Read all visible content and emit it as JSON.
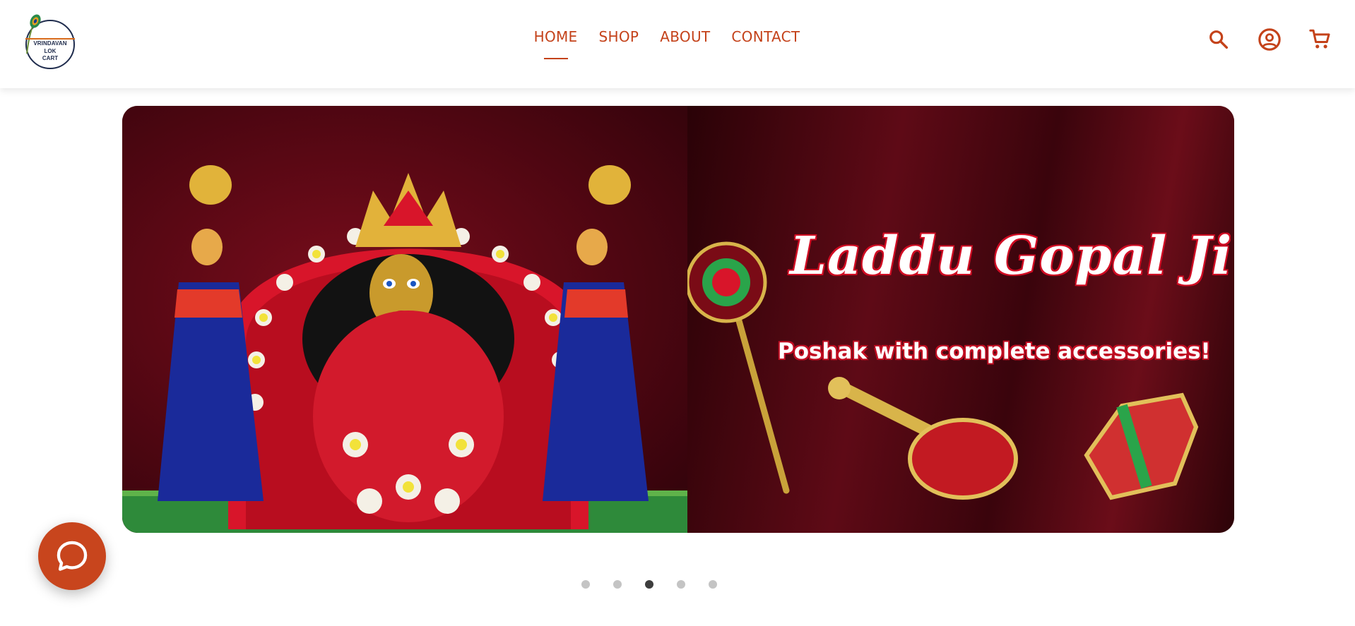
{
  "brand": {
    "logo_line1": "VRINDAVAN",
    "logo_line2": "LOK",
    "logo_line3": "CART"
  },
  "nav": {
    "items": [
      {
        "label": "HOME",
        "active": true
      },
      {
        "label": "SHOP",
        "active": false
      },
      {
        "label": "ABOUT",
        "active": false
      },
      {
        "label": "CONTACT",
        "active": false
      }
    ]
  },
  "header_icons": [
    "search-icon",
    "account-icon",
    "cart-icon"
  ],
  "banner": {
    "title": "Laddu Gopal Ji",
    "subtitle": "Poshak with complete accessories!"
  },
  "carousel": {
    "total_slides": 5,
    "active_index": 2
  },
  "chat": {
    "icon": "chat-bubble-icon"
  },
  "colors": {
    "accent": "#c4421a",
    "chat_button": "#c8451d",
    "dot_active": "#3d3d3d",
    "dot_inactive": "#c4c4c4"
  }
}
